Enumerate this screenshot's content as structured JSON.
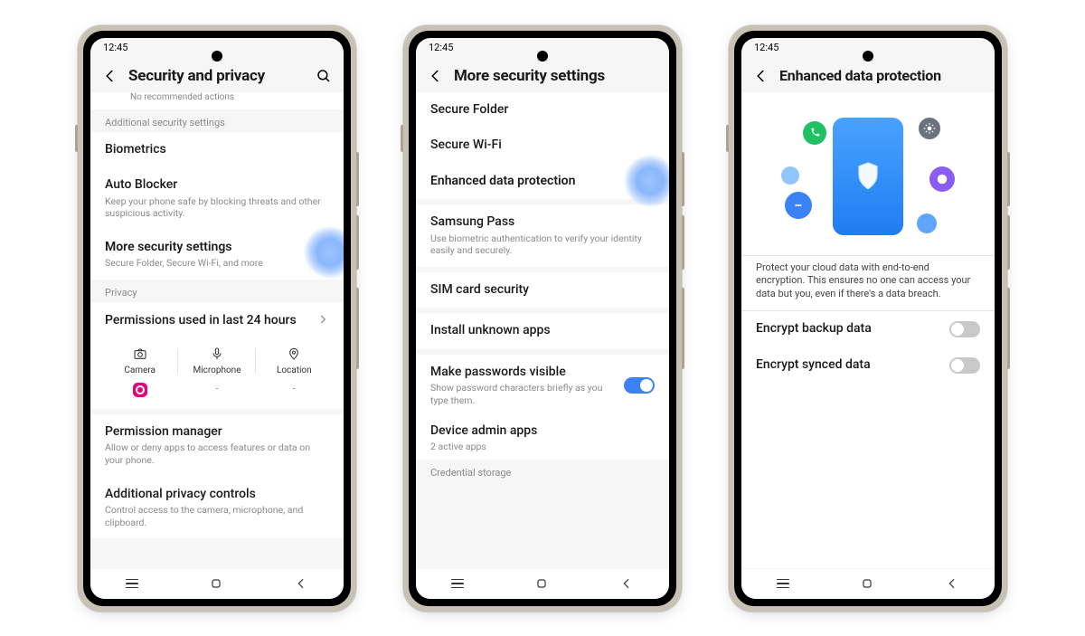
{
  "status_time": "12:45",
  "phone1": {
    "title": "Security and privacy",
    "no_rec": "No recommended actions",
    "section_additional": "Additional security settings",
    "biometrics": "Biometrics",
    "auto_blocker": {
      "title": "Auto Blocker",
      "sub": "Keep your phone safe by blocking threats and other suspicious activity."
    },
    "more_sec": {
      "title": "More security settings",
      "sub": "Secure Folder, Secure Wi-Fi, and more"
    },
    "section_privacy": "Privacy",
    "perm24": "Permissions used in last 24 hours",
    "perm_labels": {
      "camera": "Camera",
      "mic": "Microphone",
      "loc": "Location"
    },
    "perm_manager": {
      "title": "Permission manager",
      "sub": "Allow or deny apps to access features or data on your phone."
    },
    "add_privacy": {
      "title": "Additional privacy controls",
      "sub": "Control access to the camera, microphone, and clipboard."
    }
  },
  "phone2": {
    "title": "More security settings",
    "items": {
      "secure_folder": "Secure Folder",
      "secure_wifi": "Secure Wi-Fi",
      "enhanced": "Enhanced data protection",
      "samsung_pass": {
        "title": "Samsung Pass",
        "sub": "Use biometric authentication to verify your identity easily and securely."
      },
      "sim": "SIM card security",
      "install_unknown": "Install unknown apps",
      "make_pw": {
        "title": "Make passwords visible",
        "sub": "Show password characters briefly as you type them."
      },
      "device_admin": {
        "title": "Device admin apps",
        "sub": "2 active apps"
      },
      "cred_storage": "Credential storage"
    }
  },
  "phone3": {
    "title": "Enhanced data protection",
    "desc": "Protect your cloud data with end-to-end encryption. This ensures no one can access your data but you, even if there's a data breach.",
    "encrypt_backup": "Encrypt backup data",
    "encrypt_synced": "Encrypt synced data"
  }
}
